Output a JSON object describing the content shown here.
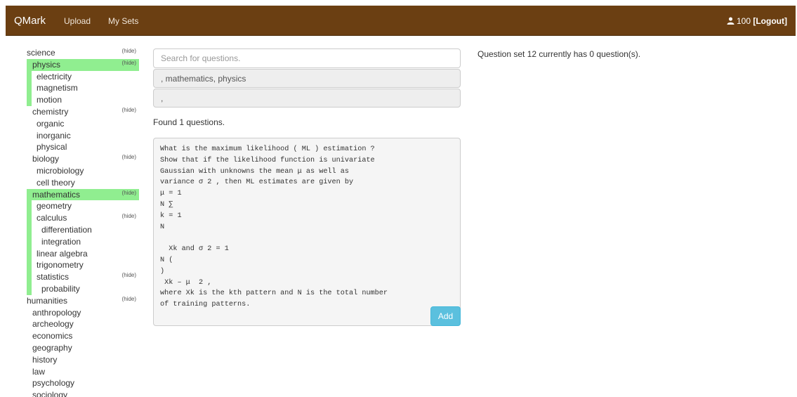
{
  "navbar": {
    "brand": "QMark",
    "links": [
      "Upload",
      "My Sets"
    ],
    "user_points": "100",
    "logout_label": "[Logout]"
  },
  "tree": {
    "hide_label": "(hide)",
    "items": [
      {
        "label": "science",
        "level": 0,
        "hide": true
      },
      {
        "label": "physics",
        "level": 1,
        "hide": true,
        "active": true
      },
      {
        "label": "electricity",
        "level": 2
      },
      {
        "label": "magnetism",
        "level": 2
      },
      {
        "label": "motion",
        "level": 2
      },
      {
        "label": "chemistry",
        "level": 1,
        "hide": true
      },
      {
        "label": "organic",
        "level": 2
      },
      {
        "label": "inorganic",
        "level": 2
      },
      {
        "label": "physical",
        "level": 2
      },
      {
        "label": "biology",
        "level": 1,
        "hide": true
      },
      {
        "label": "microbiology",
        "level": 2
      },
      {
        "label": "cell theory",
        "level": 2
      },
      {
        "label": "mathematics",
        "level": 1,
        "hide": true,
        "active": true
      },
      {
        "label": "geometry",
        "level": 2
      },
      {
        "label": "calculus",
        "level": 2,
        "hide": true
      },
      {
        "label": "differentiation",
        "level": 3
      },
      {
        "label": "integration",
        "level": 3
      },
      {
        "label": "linear algebra",
        "level": 2
      },
      {
        "label": "trigonometry",
        "level": 2
      },
      {
        "label": "statistics",
        "level": 2,
        "hide": true
      },
      {
        "label": "probability",
        "level": 3
      },
      {
        "label": "humanities",
        "level": 0,
        "hide": true
      },
      {
        "label": "anthropology",
        "level": 1
      },
      {
        "label": "archeology",
        "level": 1
      },
      {
        "label": "economics",
        "level": 1
      },
      {
        "label": "geography",
        "level": 1
      },
      {
        "label": "history",
        "level": 1
      },
      {
        "label": "law",
        "level": 1
      },
      {
        "label": "psychology",
        "level": 1
      },
      {
        "label": "sociology",
        "level": 1
      }
    ]
  },
  "search": {
    "placeholder": "Search for questions.",
    "value": "",
    "tags": ", mathematics, physics",
    "filter": ","
  },
  "results": {
    "found_text": "Found 1 questions.",
    "question_text": "What is the maximum likelihood ( ML ) estimation ?\nShow that if the likelihood function is univariate\nGaussian with unknowns the mean μ as well as\nvariance σ 2 , then ML estimates are given by\nμ = 1\nN ∑\nk = 1\nN\n\n  Xk and σ 2 = 1\nN (\n)\n Xk – μ  2 ,\nwhere Xk is the kth pattern and N is the total number\nof training patterns.",
    "add_label": "Add"
  },
  "info": {
    "set_status": "Question set 12 currently has 0 question(s)."
  },
  "colors": {
    "navbar": "#6b3f12",
    "highlight": "#90ee90",
    "add_button": "#5bc0de"
  }
}
